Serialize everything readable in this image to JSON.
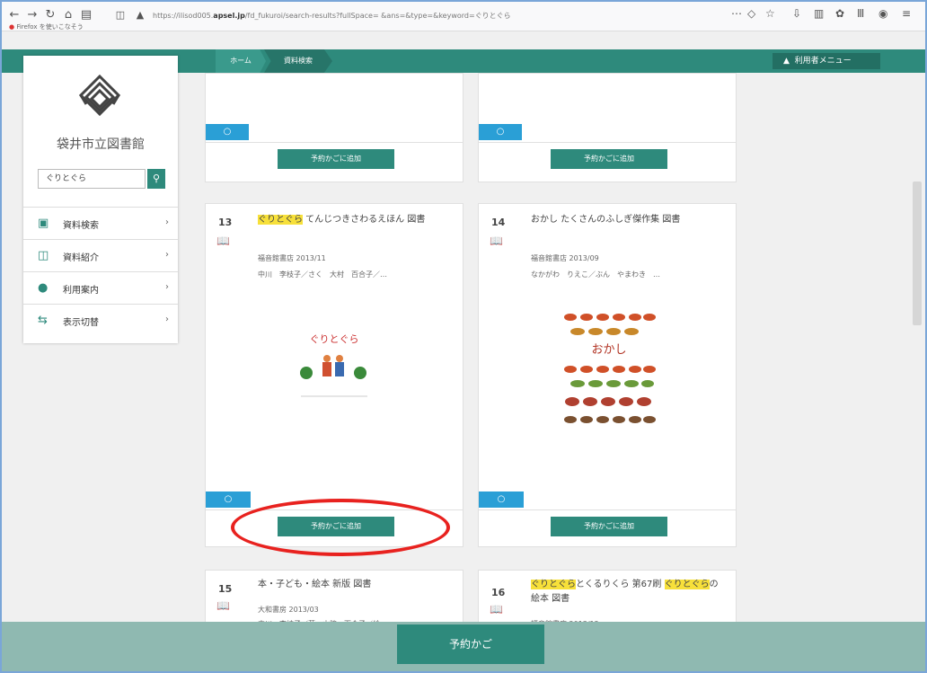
{
  "browser": {
    "url_prefix": "https://ilisod005.",
    "url_domain": "apsel.jp",
    "url_suffix": "/fd_fukuroi/search-results?fullSpace=  &ans=&type=&keyword=ぐりとぐら",
    "bookmark": "Firefox を使いこなそう"
  },
  "nav": {
    "home": "ホーム",
    "search": "資料検索",
    "user_menu": "利用者メニュー"
  },
  "sidebar": {
    "library_name": "袋井市立図書館",
    "search_value": "ぐりとぐら",
    "items": [
      {
        "icon": "search-doc-icon",
        "label": "資料検索"
      },
      {
        "icon": "book-intro-icon",
        "label": "資料紹介"
      },
      {
        "icon": "user-icon",
        "label": "利用案内"
      },
      {
        "icon": "swap-icon",
        "label": "表示切替"
      }
    ]
  },
  "cart_label": "予約かごに追加",
  "strip_label": "○",
  "cards": [
    {
      "number": "13",
      "title_hl": "ぐりとぐら",
      "title_rest": " てんじつきさわるえほん 図書",
      "publisher": "福音館書店 2013/11",
      "authors": "中川　李枝子／さく　大村　百合子／…"
    },
    {
      "number": "14",
      "title_hl": "",
      "title_rest": "おかし たくさんのふしぎ傑作集 図書",
      "publisher": "福音館書店 2013/09",
      "authors": "なかがわ　りえこ／ぶん　やまわき　…"
    },
    {
      "number": "15",
      "title_hl": "",
      "title_rest": "本・子ども・絵本 新版 図書",
      "publisher": "大和書房 2013/03",
      "authors": "中川　李枝子／著　山脇　百合子／絵"
    },
    {
      "number": "16",
      "title_hl": "ぐりとぐら",
      "title_rest": "とくるりくら 第67刷",
      "title_hl2": "ぐりとぐら",
      "title_rest2": "の絵本 図書",
      "publisher": "福音館書店 2013/12",
      "authors": ""
    }
  ],
  "cover13": {
    "title": "ぐりとぐら"
  },
  "cover14": {
    "title": "おかし"
  },
  "footer": {
    "button": "予約かご"
  },
  "colors": {
    "accent": "#2e8a7c",
    "strip": "#2a9fd6",
    "highlight": "#f7e03a",
    "annotation": "#e8221f"
  }
}
